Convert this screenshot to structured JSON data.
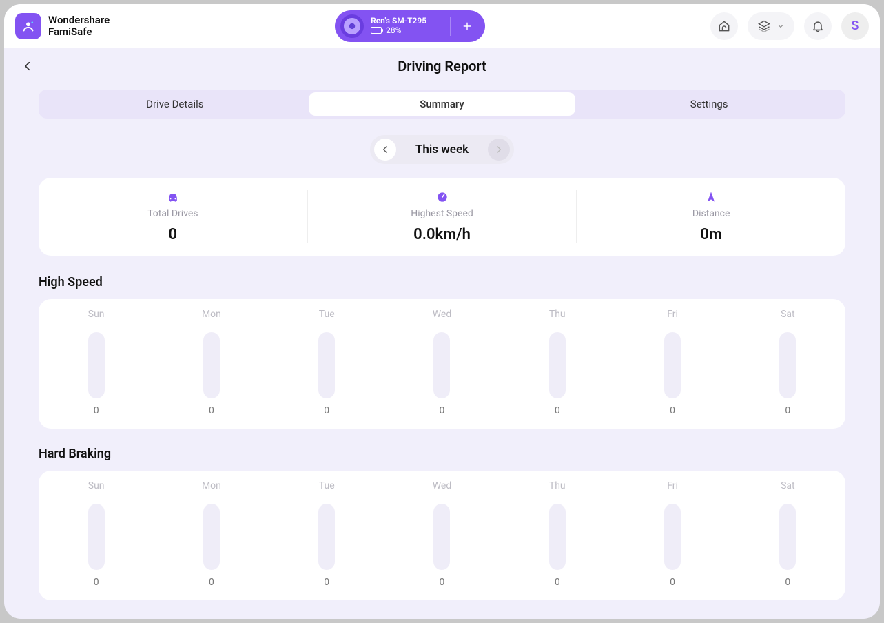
{
  "brand": {
    "line1": "Wondershare",
    "line2": "FamiSafe"
  },
  "device": {
    "name": "Ren's SM-T295",
    "battery_pct": "28%",
    "battery_fill_pct": 28
  },
  "header": {
    "avatar_letter": "S"
  },
  "page": {
    "title": "Driving Report"
  },
  "tabs": [
    {
      "label": "Drive Details",
      "active": false
    },
    {
      "label": "Summary",
      "active": true
    },
    {
      "label": "Settings",
      "active": false
    }
  ],
  "week_selector": {
    "label": "This week",
    "prev_enabled": true,
    "next_enabled": false
  },
  "stats": {
    "total_drives": {
      "label": "Total Drives",
      "value": "0"
    },
    "highest_speed": {
      "label": "Highest Speed",
      "value": "0.0km/h"
    },
    "distance": {
      "label": "Distance",
      "value": "0m"
    }
  },
  "sections": {
    "high_speed": {
      "title": "High Speed"
    },
    "hard_braking": {
      "title": "Hard Braking"
    }
  },
  "chart_data": [
    {
      "type": "bar",
      "title": "High Speed",
      "categories": [
        "Sun",
        "Mon",
        "Tue",
        "Wed",
        "Thu",
        "Fri",
        "Sat"
      ],
      "values": [
        0,
        0,
        0,
        0,
        0,
        0,
        0
      ],
      "xlabel": "",
      "ylabel": "",
      "ylim": [
        0,
        100
      ]
    },
    {
      "type": "bar",
      "title": "Hard Braking",
      "categories": [
        "Sun",
        "Mon",
        "Tue",
        "Wed",
        "Thu",
        "Fri",
        "Sat"
      ],
      "values": [
        0,
        0,
        0,
        0,
        0,
        0,
        0
      ],
      "xlabel": "",
      "ylabel": "",
      "ylim": [
        0,
        100
      ]
    }
  ]
}
